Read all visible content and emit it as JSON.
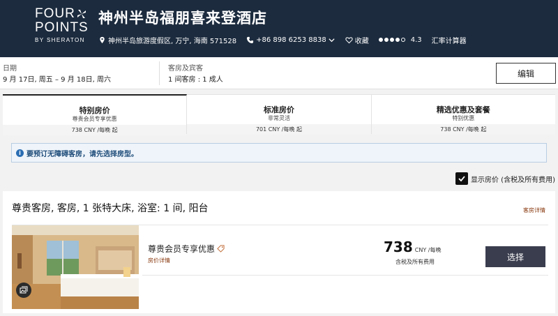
{
  "brand": {
    "line1": "FOUR",
    "line2": "POINTS",
    "line3": "BY SHERATON"
  },
  "hotel": {
    "name": "神州半岛福朋喜来登酒店",
    "address": "神州半岛旅游度假区, 万宁, 海南 571528",
    "phone": "+86 898 6253 8838",
    "favorite_label": "收藏",
    "rating": "4.3",
    "currency_label": "汇率计算器"
  },
  "search": {
    "date_label": "日期",
    "date_value": "9 月 17日, 周五 – 9 月 18日, 周六",
    "rooms_label": "客房及宾客",
    "rooms_value": "1 间客房 : 1 成人",
    "edit_label": "编辑"
  },
  "tabs": [
    {
      "title": "特别房价",
      "subtitle": "尊贵会员专享优惠",
      "price": "738 CNY /每晚 起"
    },
    {
      "title": "标准房价",
      "subtitle": "非常灵活",
      "price": "701 CNY /每晚 起"
    },
    {
      "title": "精选优惠及套餐",
      "subtitle": "特别优惠",
      "price": "738 CNY /每晚 起"
    }
  ],
  "alert": {
    "text": "要预订无障碍客房，请先选择房型。"
  },
  "show_price": {
    "label": "显示房价 (含税及所有费用)"
  },
  "room": {
    "title": "尊贵客房, 客房, 1 张特大床, 浴室: 1 间, 阳台",
    "details_label": "客房详情",
    "rate_name": "尊贵会员专享优惠",
    "rate_details_label": "房价详情",
    "price": "738",
    "price_unit": "CNY /每晚",
    "price_note": "含税及所有费用",
    "select_label": "选择"
  },
  "colors": {
    "header_bg": "#1c2b3e",
    "accent_link": "#8a3b12",
    "select_button": "#3a3d4e",
    "alert_bg": "#eef4fa"
  },
  "icons": [
    "four-points-logo-mark",
    "location-pin-icon",
    "phone-icon",
    "chevron-down-icon",
    "heart-icon",
    "rating-dots-icon",
    "info-icon",
    "checkbox-checked-icon",
    "gallery-icon",
    "member-tag-icon"
  ]
}
